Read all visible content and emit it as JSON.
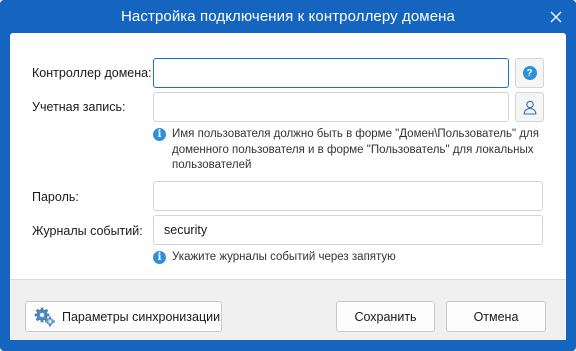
{
  "window": {
    "title": "Настройка подключения к контроллеру домена"
  },
  "form": {
    "domain_controller": {
      "label": "Контроллер домена:",
      "value": ""
    },
    "account": {
      "label": "Учетная запись:",
      "value": ""
    },
    "account_hint": "Имя пользователя должно быть в форме \"Домен\\Пользователь\" для доменного пользователя и в форме \"Пользователь\" для локальных пользователей",
    "password": {
      "label": "Пароль:",
      "value": ""
    },
    "event_logs": {
      "label": "Журналы событий:",
      "value": "security"
    },
    "event_logs_hint": "Укажите журналы событий через запятую"
  },
  "footer": {
    "sync_settings_label": "Параметры синхронизации",
    "save_label": "Сохранить",
    "cancel_label": "Отмена"
  },
  "colors": {
    "accent": "#1565c0",
    "focus_border": "#1a6fd6",
    "info_icon": "#2f8fd8"
  }
}
